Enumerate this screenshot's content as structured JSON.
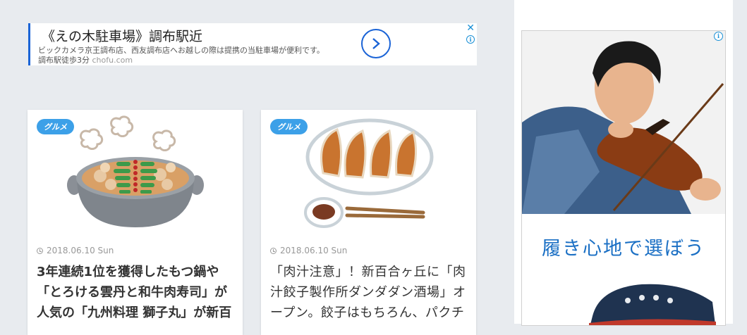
{
  "banner_ad": {
    "title": "《えの木駐車場》調布駅近",
    "description": "ビックカメラ京王調布店、西友調布店へお越しの際は提携の当駐車場が便利です。",
    "location": "調布駅徒歩3分",
    "domain": "chofu.com",
    "close_glyph": "✕",
    "info_glyph": "i"
  },
  "articles": [
    {
      "category": "グルメ",
      "date": "2018.06.10 Sun",
      "title": "3年連続1位を獲得したもつ鍋や「とろける雲丹と和牛肉寿司」が人気の「九州料理 獅子丸」が新百"
    },
    {
      "category": "グルメ",
      "date": "2018.06.10 Sun",
      "title": "「肉汁注意」！新百合ヶ丘に「肉汁餃子製作所ダンダダン酒場」オープン。餃子はもちろん、パクチ"
    }
  ],
  "side_ad": {
    "tagline": "履き心地で選ぼう",
    "info_glyph": "i"
  },
  "colors": {
    "background": "#e8ebef",
    "tag": "#3ca0e8",
    "link_blue": "#1a63d6",
    "tagline": "#1a6fc4"
  }
}
